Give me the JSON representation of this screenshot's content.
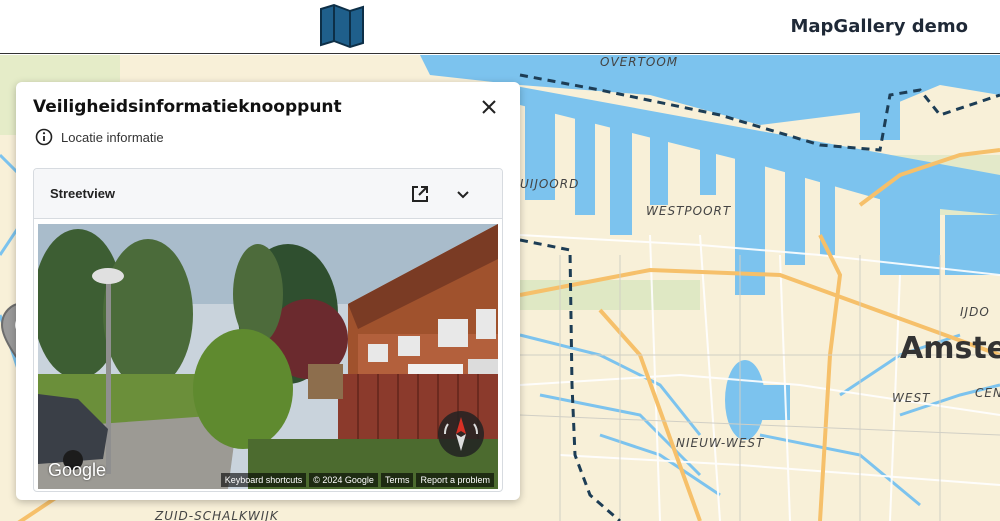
{
  "header": {
    "app_title": "MapGallery demo",
    "logo_icon": "map-icon"
  },
  "map": {
    "labels": {
      "overtoom": "OVERTOOM",
      "uijoord": "UIJOORD",
      "westpoort": "WESTPOORT",
      "nieuw_west": "NIEUW-WEST",
      "amsterdam": "Amster",
      "west": "WEST",
      "ijdo": "IJDO",
      "cen": "CEN",
      "zuid_schalkwijk": "ZUID-SCHALKWIJK"
    },
    "colors": {
      "land": "#f8f0d8",
      "water": "#7cc3ee",
      "road": "#f6c06a",
      "boundary": "#1d3d55"
    }
  },
  "panel": {
    "title": "Veiligheidsinformatieknooppunt",
    "info_label": "Locatie informatie",
    "card": {
      "title": "Streetview",
      "image_alt": "Street view of brick terraced houses with garden, trees and a street lamp",
      "google_logo": "Google",
      "footer": [
        "Keyboard shortcuts",
        "© 2024 Google",
        "Terms",
        "Report a problem"
      ]
    }
  }
}
